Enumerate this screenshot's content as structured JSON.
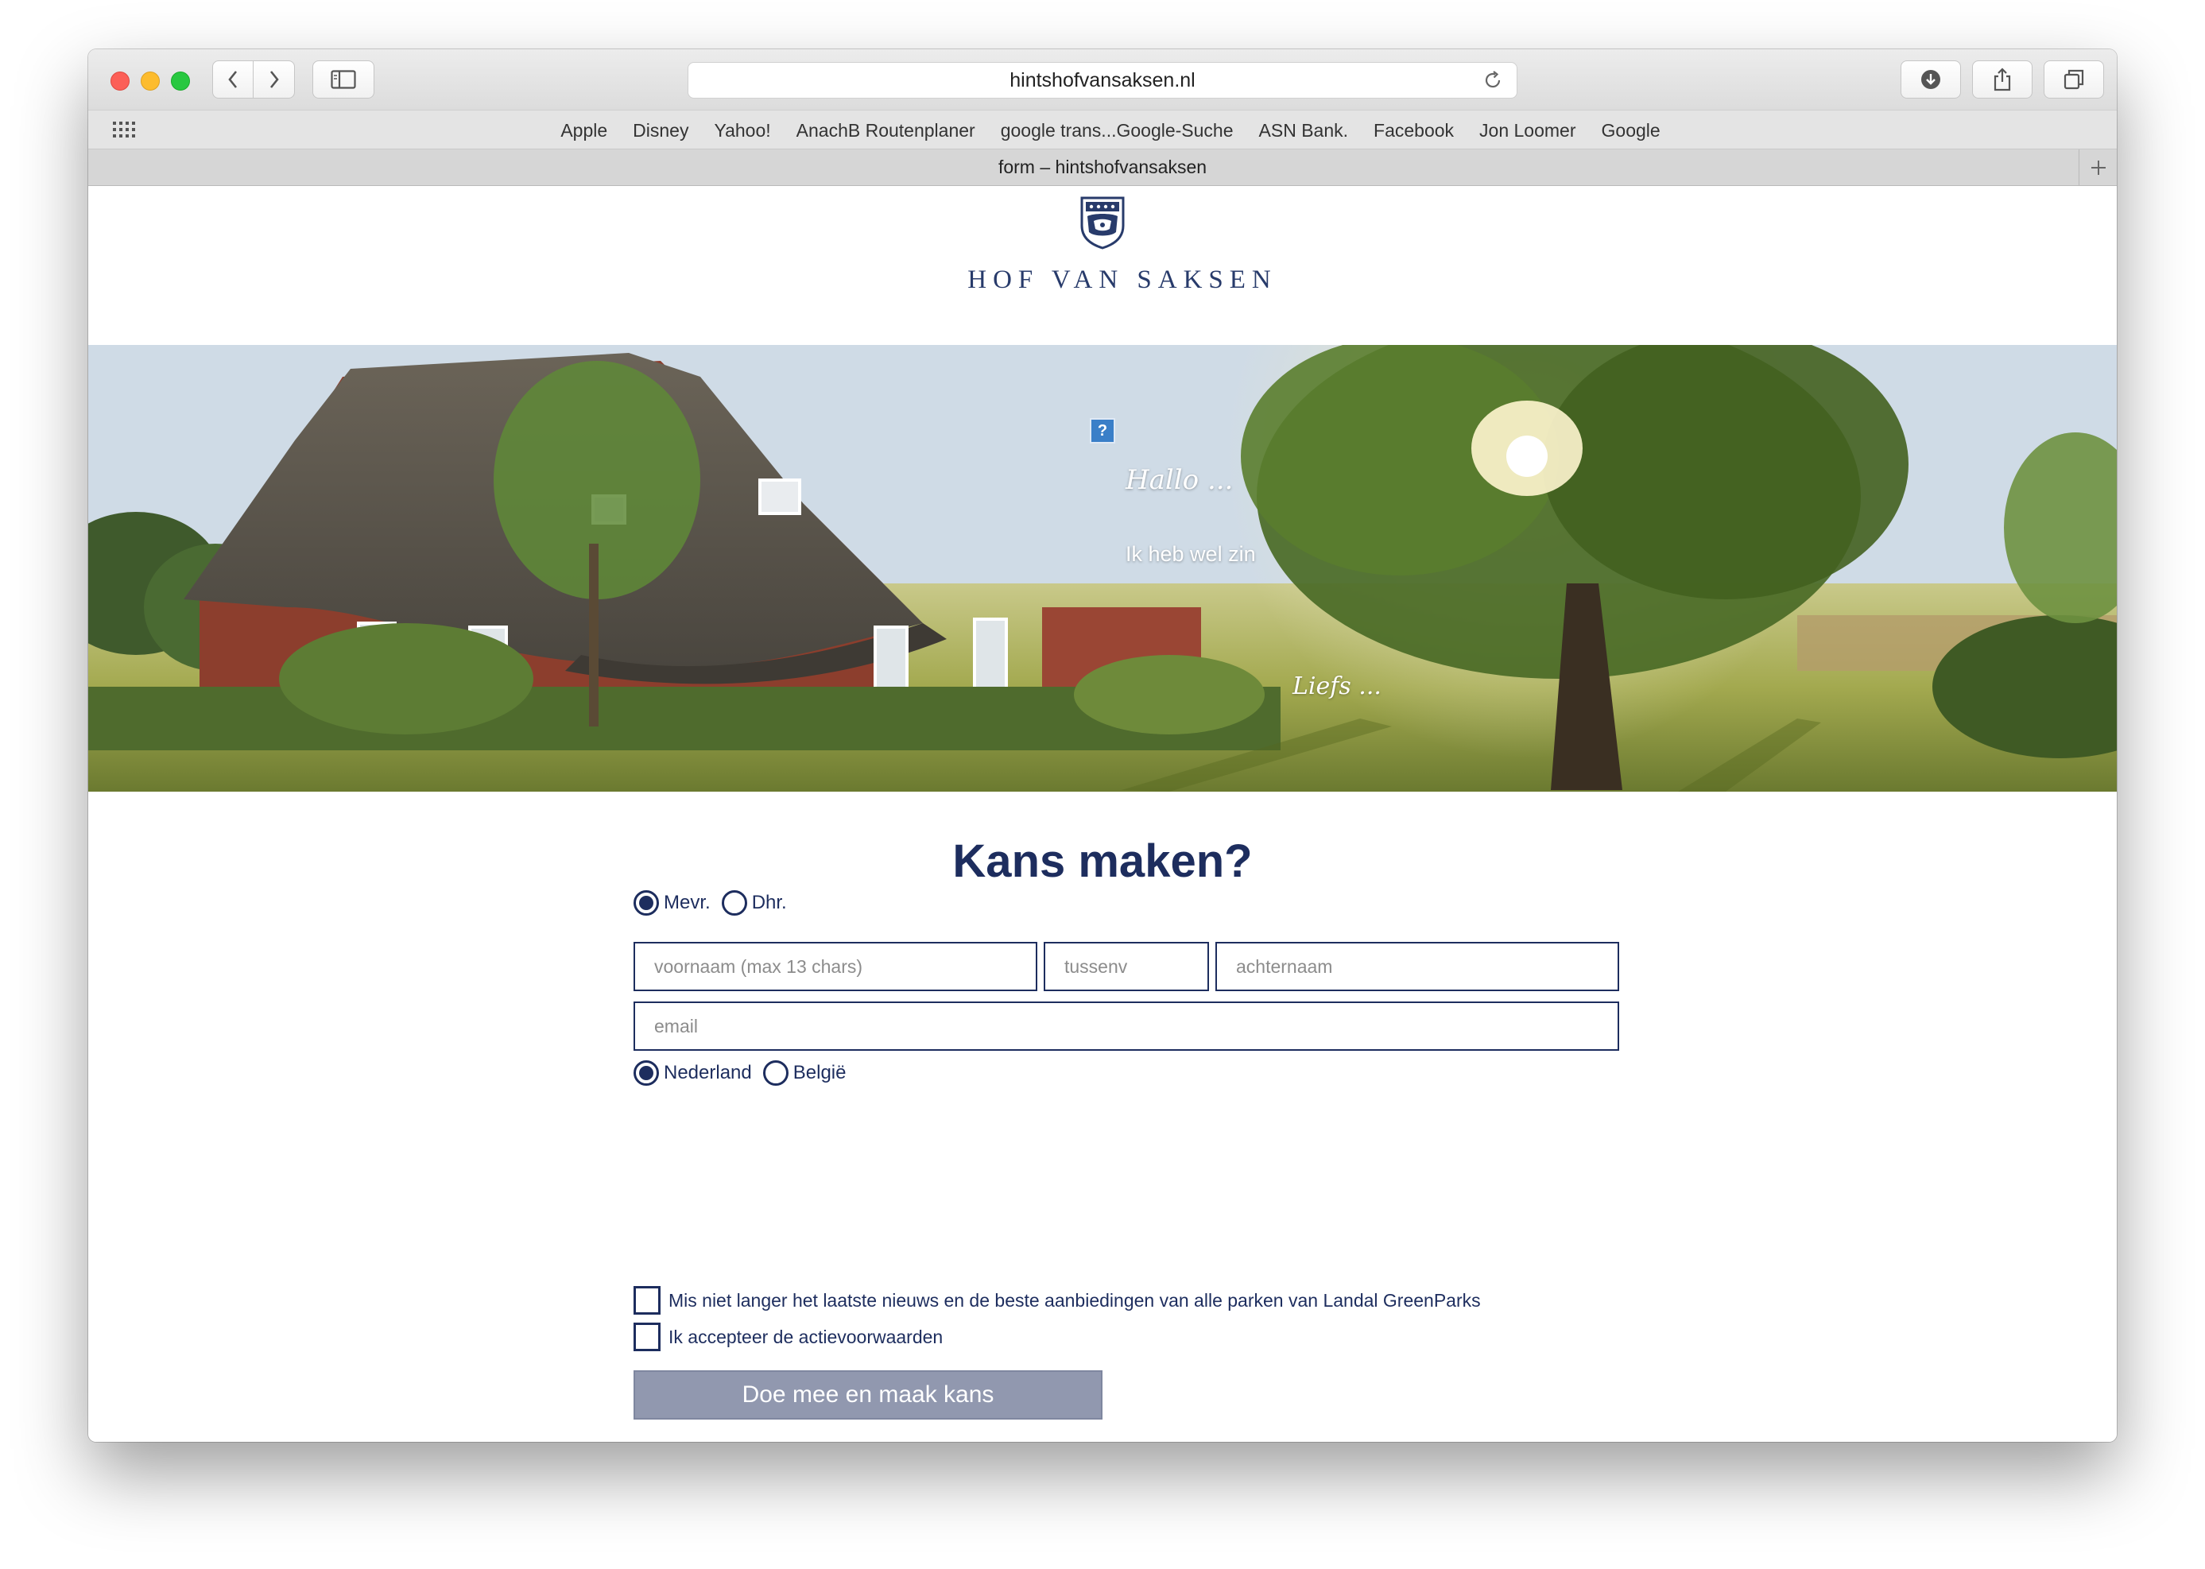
{
  "browser": {
    "url": "hintshofvansaksen.nl",
    "tab_title": "form – hintshofvansaksen",
    "bookmarks": [
      "Apple",
      "Disney",
      "Yahoo!",
      "AnachB Routenplaner",
      "google trans...Google-Suche",
      "ASN Bank.",
      "Facebook",
      "Jon Loomer",
      "Google"
    ]
  },
  "header": {
    "brand": "HOF VAN SAKSEN"
  },
  "hero": {
    "help_glyph": "?",
    "greeting": "Hallo ...",
    "tagline": "Ik heb wel zin",
    "signoff": "Liefs ..."
  },
  "form": {
    "title": "Kans maken?",
    "salutation_options": [
      "Mevr.",
      "Dhr."
    ],
    "salutation_selected": "Mevr.",
    "first_name_placeholder": "voornaam (max 13 chars)",
    "infix_placeholder": "tussenv",
    "last_name_placeholder": "achternaam",
    "email_placeholder": "email",
    "country_options": [
      "Nederland",
      "België"
    ],
    "country_selected": "Nederland",
    "newsletter_label": "Mis niet langer het laatste nieuws en de beste aanbiedingen van alle parken van Landal GreenParks",
    "terms_label": "Ik accepteer de actievoorwaarden",
    "submit_label": "Doe mee en maak kans"
  },
  "colors": {
    "brand_navy": "#1d2d5e",
    "submit_bg": "#9198af"
  }
}
